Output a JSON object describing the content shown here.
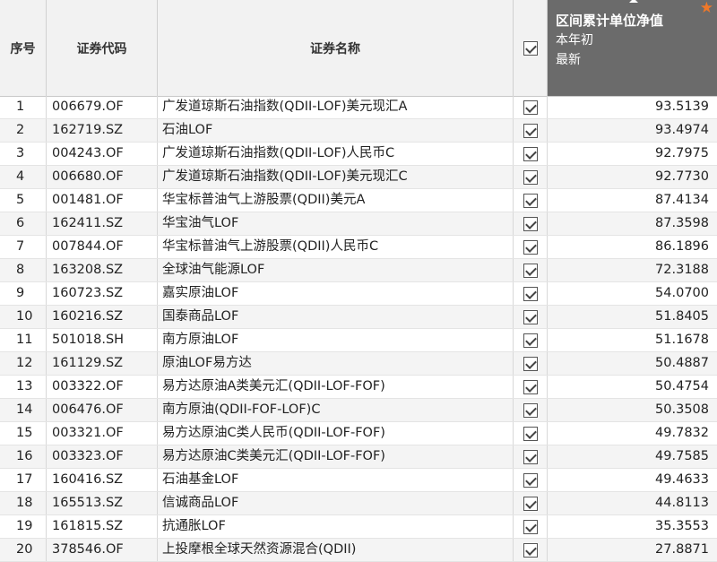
{
  "header": {
    "col_index": "序号",
    "col_code": "证券代码",
    "col_name": "证券名称",
    "col_value_line1": "区间累计单位净值",
    "col_value_line2": "本年初",
    "col_value_line3": "最新",
    "star_icon": "orange-star",
    "star_color": "#f07828"
  },
  "rows": [
    {
      "idx": "1",
      "code": "006679.OF",
      "name": "广发道琼斯石油指数(QDII-LOF)美元现汇A",
      "checked": true,
      "value": "93.5139"
    },
    {
      "idx": "2",
      "code": "162719.SZ",
      "name": "石油LOF",
      "checked": true,
      "value": "93.4974"
    },
    {
      "idx": "3",
      "code": "004243.OF",
      "name": "广发道琼斯石油指数(QDII-LOF)人民币C",
      "checked": true,
      "value": "92.7975"
    },
    {
      "idx": "4",
      "code": "006680.OF",
      "name": "广发道琼斯石油指数(QDII-LOF)美元现汇C",
      "checked": true,
      "value": "92.7730"
    },
    {
      "idx": "5",
      "code": "001481.OF",
      "name": "华宝标普油气上游股票(QDII)美元A",
      "checked": true,
      "value": "87.4134"
    },
    {
      "idx": "6",
      "code": "162411.SZ",
      "name": "华宝油气LOF",
      "checked": true,
      "value": "87.3598"
    },
    {
      "idx": "7",
      "code": "007844.OF",
      "name": "华宝标普油气上游股票(QDII)人民币C",
      "checked": true,
      "value": "86.1896"
    },
    {
      "idx": "8",
      "code": "163208.SZ",
      "name": "全球油气能源LOF",
      "checked": true,
      "value": "72.3188"
    },
    {
      "idx": "9",
      "code": "160723.SZ",
      "name": "嘉实原油LOF",
      "checked": true,
      "value": "54.0700"
    },
    {
      "idx": "10",
      "code": "160216.SZ",
      "name": "国泰商品LOF",
      "checked": true,
      "value": "51.8405"
    },
    {
      "idx": "11",
      "code": "501018.SH",
      "name": "南方原油LOF",
      "checked": true,
      "value": "51.1678"
    },
    {
      "idx": "12",
      "code": "161129.SZ",
      "name": "原油LOF易方达",
      "checked": true,
      "value": "50.4887"
    },
    {
      "idx": "13",
      "code": "003322.OF",
      "name": "易方达原油A类美元汇(QDII-LOF-FOF)",
      "checked": true,
      "value": "50.4754"
    },
    {
      "idx": "14",
      "code": "006476.OF",
      "name": "南方原油(QDII-FOF-LOF)C",
      "checked": true,
      "value": "50.3508"
    },
    {
      "idx": "15",
      "code": "003321.OF",
      "name": "易方达原油C类人民币(QDII-LOF-FOF)",
      "checked": true,
      "value": "49.7832"
    },
    {
      "idx": "16",
      "code": "003323.OF",
      "name": "易方达原油C类美元汇(QDII-LOF-FOF)",
      "checked": true,
      "value": "49.7585"
    },
    {
      "idx": "17",
      "code": "160416.SZ",
      "name": "石油基金LOF",
      "checked": true,
      "value": "49.4633"
    },
    {
      "idx": "18",
      "code": "165513.SZ",
      "name": "信诚商品LOF",
      "checked": true,
      "value": "44.8113"
    },
    {
      "idx": "19",
      "code": "161815.SZ",
      "name": "抗通胀LOF",
      "checked": true,
      "value": "35.3553"
    },
    {
      "idx": "20",
      "code": "378546.OF",
      "name": "上投摩根全球天然资源混合(QDII)",
      "checked": true,
      "value": "27.8871"
    }
  ]
}
